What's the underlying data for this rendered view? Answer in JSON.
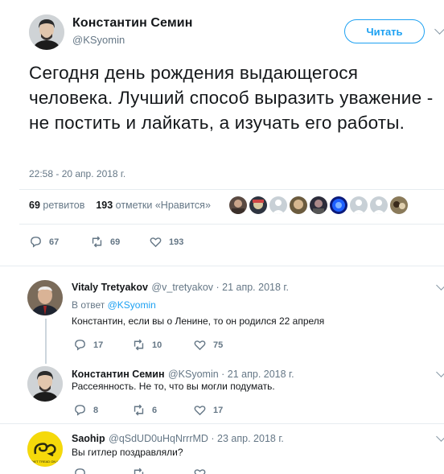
{
  "tweet": {
    "author_name": "Константин Семин",
    "author_handle": "@KSyomin",
    "follow_label": "Читать",
    "text": "Сегодня день рождения выдающегося человека. Лучший способ выразить уважение - не постить и лайкать, а изучать его работы.",
    "timestamp": "22:58 - 20 апр. 2018 г.",
    "retweets_count": "69",
    "retweets_label": "ретвитов",
    "likes_count": "193",
    "likes_label": "отметки «Нравится»",
    "actions": {
      "replies": "67",
      "retweets": "69",
      "likes": "193"
    }
  },
  "replies": [
    {
      "name": "Vitaly Tretyakov",
      "handle_date": "@v_tretyakov · 21 апр. 2018 г.",
      "reply_to_prefix": "В ответ",
      "reply_to_mention": "@KSyomin",
      "text": "Константин, если вы о Ленине, то он родился 22 апреля",
      "replies": "17",
      "retweets": "10",
      "likes": "75"
    },
    {
      "name": "Константин Семин",
      "handle_date": "@KSyomin · 21 апр. 2018 г.",
      "text": "Рассеянность. Не то, что вы могли подумать.",
      "replies": "8",
      "retweets": "6",
      "likes": "17"
    },
    {
      "name": "Saohip",
      "handle_date": "@qSdUD0uHqNrrrMD · 23 апр. 2018 г.",
      "text": "Вы гитлер поздравляли?",
      "avatar_text": "DON'T TREAD ON ME"
    }
  ],
  "colors": {
    "accent": "#1da1f2",
    "muted": "#657786",
    "text": "#14171a",
    "divider": "#e6ecf0"
  }
}
